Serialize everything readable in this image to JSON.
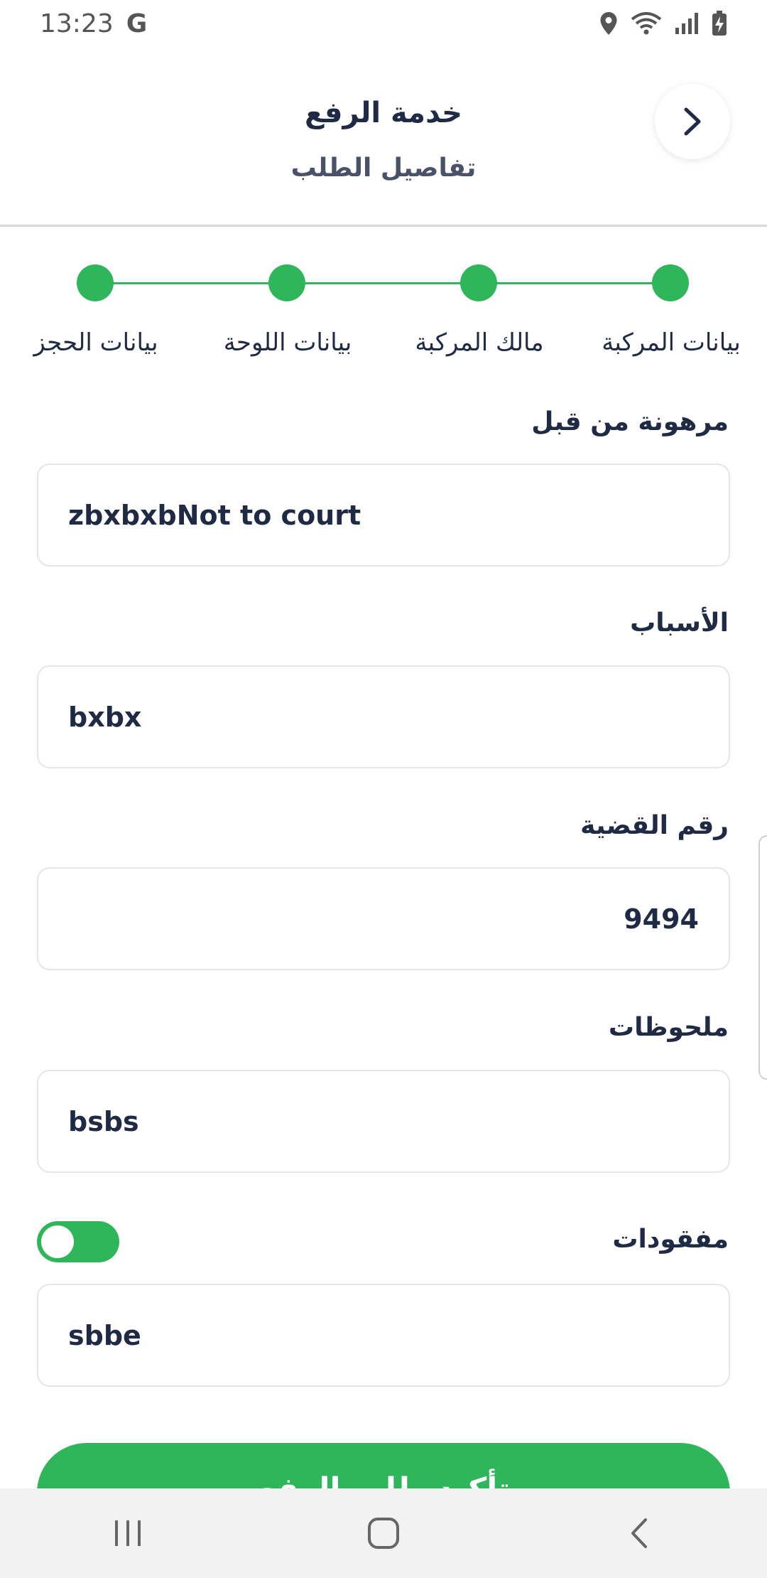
{
  "status_bar": {
    "time": "13:23",
    "g_logo": "G"
  },
  "header": {
    "title": "خدمة الرفع",
    "subtitle": "تفاصيل الطلب"
  },
  "stepper": {
    "steps": [
      {
        "label": "بيانات المركبة"
      },
      {
        "label": "مالك المركبة"
      },
      {
        "label": "بيانات اللوحة"
      },
      {
        "label": "بيانات الحجز"
      }
    ]
  },
  "fields": {
    "mortgaged": {
      "label": "مرهونة من قبل",
      "value": "zbxbxbNot to court"
    },
    "reasons": {
      "label": "الأسباب",
      "value": "bxbx"
    },
    "case_number": {
      "label": "رقم القضية",
      "value": "9494"
    },
    "notes": {
      "label": "ملحوظات",
      "value": "bsbs"
    },
    "lost_items": {
      "label": "مفقودات",
      "value": "sbbe",
      "toggle_on": true
    }
  },
  "confirm_button": {
    "label": "تأكيد طلب الرفع"
  },
  "colors": {
    "accent": "#2fb55a",
    "text": "#1f2a44"
  }
}
